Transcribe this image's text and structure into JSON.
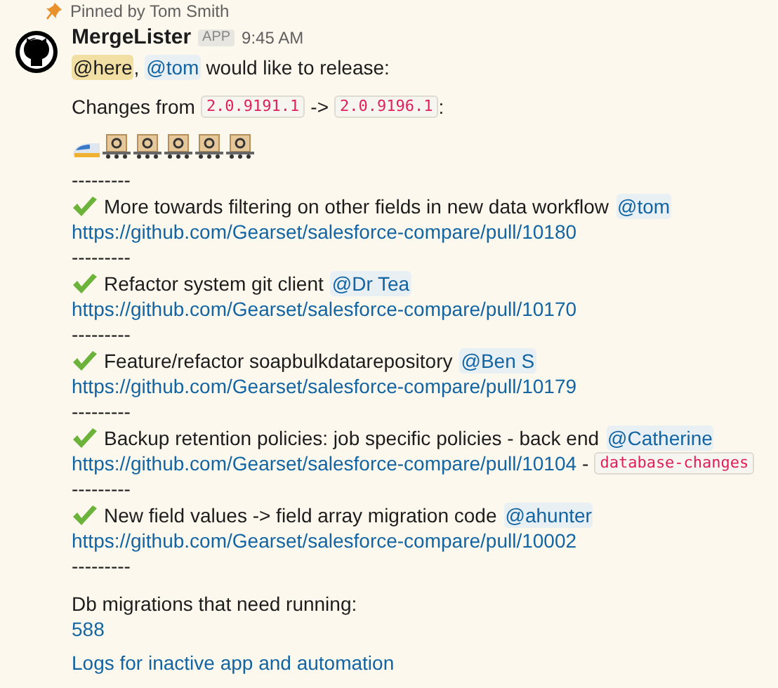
{
  "pinned": {
    "text": "Pinned by Tom Smith"
  },
  "message": {
    "author": "MergeLister",
    "badge": "APP",
    "time": "9:45 AM",
    "mentions": [
      {
        "text": "@here",
        "kind": "broadcast"
      },
      {
        "text": "@tom",
        "kind": "user"
      }
    ],
    "mentions_separator": ",",
    "intro": "would like to release:",
    "changes_label": "Changes from",
    "from_version": "2.0.9191.1",
    "arrow": "->",
    "to_version": "2.0.9196.1",
    "changes_suffix": ":",
    "train": [
      {
        "kind": "engine"
      },
      {
        "kind": "car"
      },
      {
        "kind": "car"
      },
      {
        "kind": "car"
      },
      {
        "kind": "car"
      },
      {
        "kind": "car"
      }
    ],
    "separator": "---------",
    "releases": [
      {
        "title": "More towards filtering on other fields in new data workflow",
        "mention": "@tom",
        "url": "https://github.com/Gearset/salesforce-compare/pull/10180",
        "separator": "---------"
      },
      {
        "title": "Refactor system git client",
        "mention": "@Dr Tea",
        "url": "https://github.com/Gearset/salesforce-compare/pull/10170",
        "separator": "---------"
      },
      {
        "title": "Feature/refactor soapbulkdatarepository",
        "mention": "@Ben S",
        "url": "https://github.com/Gearset/salesforce-compare/pull/10179",
        "separator": "---------"
      },
      {
        "title": "Backup retention policies: job specific policies - back end",
        "mention": "@Catherine",
        "url": "https://github.com/Gearset/salesforce-compare/pull/10104",
        "tag_separator": "-",
        "tag": "database-changes",
        "separator": "---------"
      },
      {
        "title": "New field values -> field array migration code",
        "mention": "@ahunter",
        "url": "https://github.com/Gearset/salesforce-compare/pull/10002",
        "separator": "---------"
      }
    ],
    "migrations_label": "Db migrations that need running:",
    "migrations_link": "588",
    "logs_link": "Logs for inactive app and automation"
  }
}
